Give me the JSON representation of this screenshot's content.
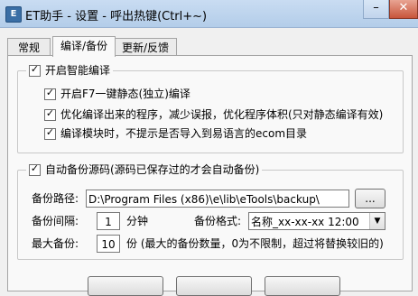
{
  "window": {
    "app_icon_text": "E",
    "title": "ET助手 - 设置 - 呼出热键(Ctrl+~)",
    "minimize_glyph": "–",
    "close_glyph": "✕"
  },
  "tabs": [
    {
      "label": "常规",
      "active": false
    },
    {
      "label": "编译/备份",
      "active": true
    },
    {
      "label": "更新/反馈",
      "active": false
    }
  ],
  "compile": {
    "smart_compile_label": "开启智能编译",
    "smart_compile_checked": true,
    "options": [
      {
        "label": "开启F7一键静态(独立)编译",
        "checked": true
      },
      {
        "label": "优化编译出来的程序，减少误报，优化程序体积(只对静态编译有效)",
        "checked": true
      },
      {
        "label": "编译模块时，不提示是否导入到易语言的ecom目录",
        "checked": true
      }
    ]
  },
  "backup": {
    "auto_backup_label": "自动备份源码(源码已保存过的才会自动备份)",
    "auto_backup_checked": true,
    "path_label": "备份路径:",
    "path_value": "D:\\Program Files (x86)\\e\\lib\\eTools\\backup\\",
    "browse_label": "...",
    "interval_label": "备份间隔:",
    "interval_value": "1",
    "interval_unit": "分钟",
    "format_label": "备份格式:",
    "format_value": "名称_xx-xx-xx 12:00",
    "max_label": "最大备份:",
    "max_value": "10",
    "max_unit": "份 (最大的备份数量，0为不限制，超过将替换较旧的)"
  },
  "icons": {
    "check": "✓",
    "dropdown": "▼"
  }
}
